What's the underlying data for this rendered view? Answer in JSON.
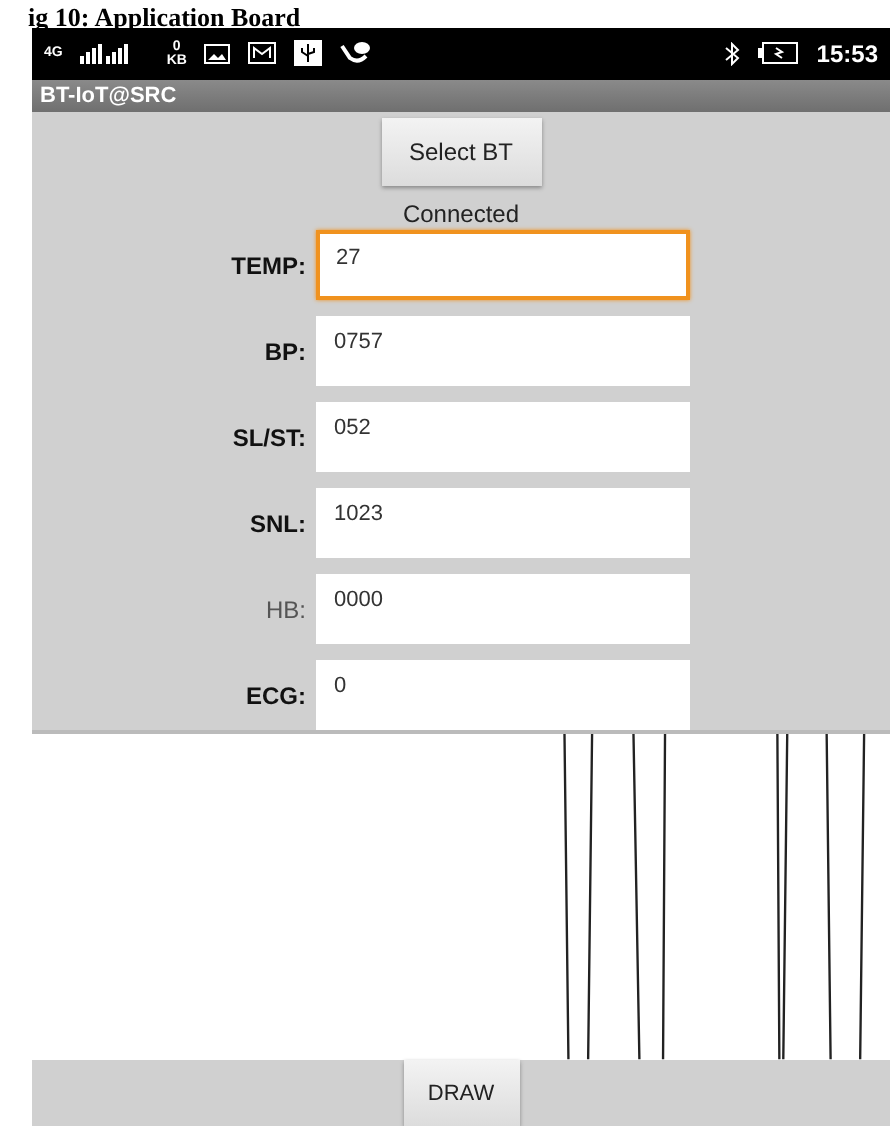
{
  "caption": "ig 10: Application Board",
  "status_bar": {
    "network": "4G",
    "data_rate": "0 KB",
    "time": "15:53"
  },
  "app_bar": {
    "title": "BT-IoT@SRC"
  },
  "select_button": "Select BT",
  "connection_status": "Connected",
  "fields": [
    {
      "label": "TEMP:",
      "value": "27",
      "bold": true,
      "focused": true
    },
    {
      "label": "BP:",
      "value": "0757",
      "bold": true,
      "focused": false
    },
    {
      "label": "SL/ST:",
      "value": "052",
      "bold": true,
      "focused": false
    },
    {
      "label": "SNL:",
      "value": "1023",
      "bold": true,
      "focused": false
    },
    {
      "label": "HB:",
      "value": "0000",
      "bold": false,
      "focused": false
    },
    {
      "label": "ECG:",
      "value": "0",
      "bold": true,
      "focused": false
    }
  ],
  "draw_button": "DRAW"
}
